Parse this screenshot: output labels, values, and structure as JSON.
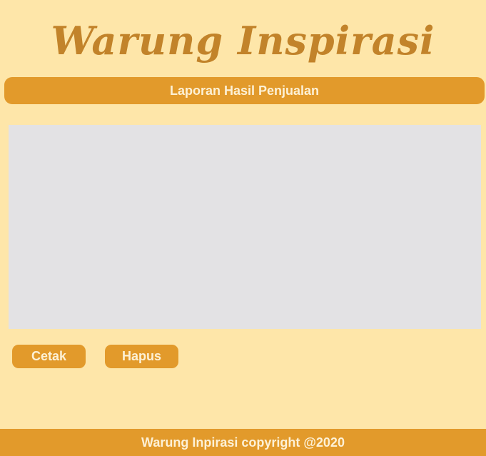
{
  "header": {
    "title": "Warung Inspirasi"
  },
  "section": {
    "title": "Laporan Hasil Penjualan"
  },
  "report": {
    "content": ""
  },
  "actions": {
    "print_label": "Cetak",
    "delete_label": "Hapus"
  },
  "footer": {
    "text": "Warung Inpirasi copyright @2020"
  },
  "colors": {
    "background": "#fee6a9",
    "accent": "#e29a2b",
    "title": "#c2832a",
    "report_area": "#e3e2e4",
    "button_text": "#fdf1d6"
  }
}
